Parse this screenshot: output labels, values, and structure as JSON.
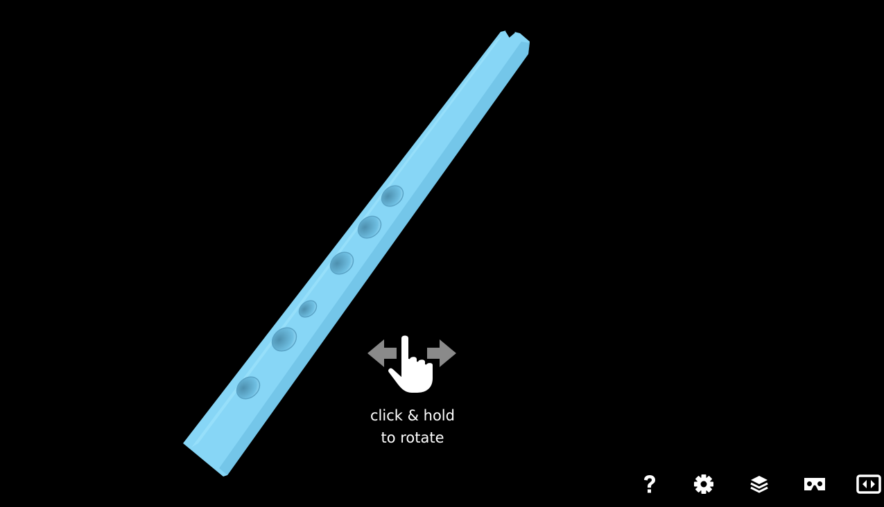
{
  "viewer": {
    "model": "flute-3d-model",
    "model_color": "#8cd8f8",
    "background_color": "#000000"
  },
  "hint": {
    "line1": "click & hold",
    "line2": "to rotate",
    "icon": "hand-drag-icon"
  },
  "toolbar": {
    "buttons": [
      {
        "name": "help-button",
        "icon": "question-icon"
      },
      {
        "name": "settings-button",
        "icon": "gear-icon"
      },
      {
        "name": "layers-button",
        "icon": "layers-icon"
      },
      {
        "name": "vr-button",
        "icon": "vr-cardboard-icon"
      },
      {
        "name": "fullscreen-button",
        "icon": "expand-icon"
      }
    ]
  }
}
